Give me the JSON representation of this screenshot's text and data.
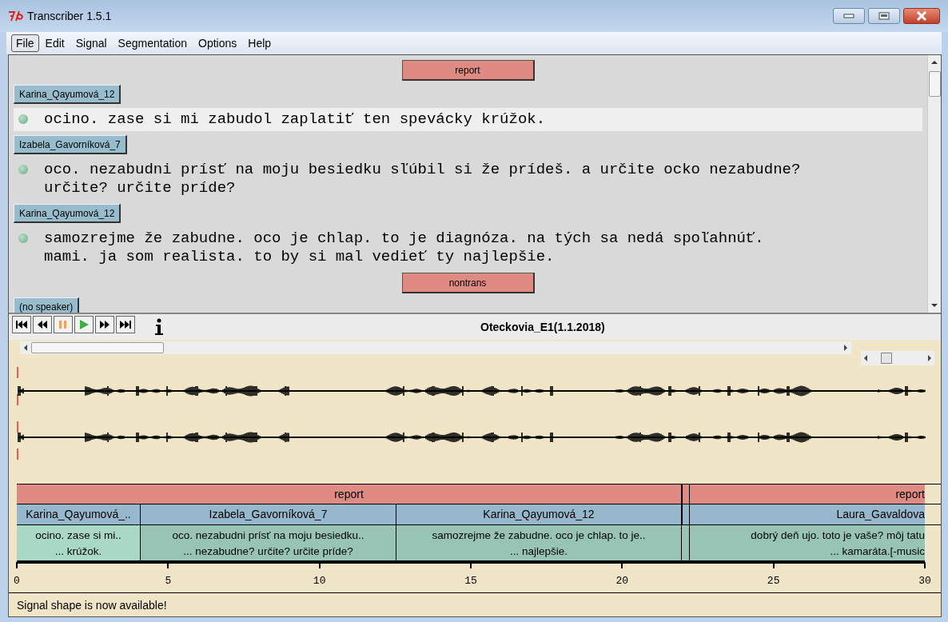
{
  "window": {
    "title": "Transcriber 1.5.1"
  },
  "menu": [
    {
      "label": "File",
      "selected": true
    },
    {
      "label": "Edit",
      "selected": false
    },
    {
      "label": "Signal",
      "selected": false
    },
    {
      "label": "Segmentation",
      "selected": false
    },
    {
      "label": "Options",
      "selected": false
    },
    {
      "label": "Help",
      "selected": false
    }
  ],
  "editor": [
    {
      "kind": "section",
      "label": "report"
    },
    {
      "kind": "speaker",
      "label": "Karina_Qayumová_12"
    },
    {
      "kind": "turn",
      "text": "ocino. zase si mi zabudol zaplatiť ten spevácky krúžok.",
      "selected": true
    },
    {
      "kind": "speaker",
      "label": "Izabela_Gavorníková_7"
    },
    {
      "kind": "turn",
      "text": "oco. nezabudni prísť na moju besiedku sľúbil si že prídeš. a určite ocko nezabudne?\nurčite? určite príde?",
      "selected": false
    },
    {
      "kind": "speaker",
      "label": "Karina_Qayumová_12"
    },
    {
      "kind": "turn",
      "text": "samozrejme že zabudne. oco je chlap. to je diagnóza. na tých sa nedá spoľahnúť.\nmami. ja som realista. to by si mal vedieť ty najlepšie.",
      "selected": false
    },
    {
      "kind": "section",
      "label": "nontrans"
    },
    {
      "kind": "speaker",
      "label": "(no speaker)"
    }
  ],
  "player": {
    "buttons": [
      {
        "kind": "first"
      },
      {
        "kind": "rewind"
      },
      {
        "kind": "pause"
      },
      {
        "kind": "play"
      },
      {
        "kind": "forward"
      },
      {
        "kind": "last"
      },
      {
        "kind": "info"
      }
    ],
    "title": "Oteckovia_E1(1.1.2018)"
  },
  "resolution": {
    "level": 0.3
  },
  "timeline": {
    "sections": [
      {
        "kind": "segment",
        "label": "report"
      },
      {
        "kind": "gap"
      },
      {
        "kind": "segment",
        "label": "report"
      }
    ],
    "speakers": [
      {
        "kind": "segment",
        "label": "Karina_Qayumová_.."
      },
      {
        "kind": "segment",
        "label": "Izabela_Gavorníková_7"
      },
      {
        "kind": "segment",
        "label": "Karina_Qayumová_12"
      },
      {
        "kind": "gap"
      },
      {
        "kind": "segment",
        "label": "Laura_Gavaldova"
      }
    ],
    "segments": [
      {
        "text": "ocino. zase si mi..\n... krúžok.",
        "selected": true
      },
      {
        "text": "oco. nezabudni prísť na moju besiedku..\n... nezabudne? určite? určite príde?",
        "selected": false
      },
      {
        "text": "samozrejme že zabudne. oco je chlap. to je..\n... najlepšie.",
        "selected": false
      },
      {
        "selected": false
      },
      {
        "text": "dobrý deň ujo. toto je vaše? môj tatu\n... kamaráta.[-music",
        "selected": false
      }
    ],
    "ticks": [
      "0",
      "5",
      "10",
      "15",
      "20",
      "25",
      "30"
    ]
  },
  "status_bar": "Signal shape is now available!"
}
